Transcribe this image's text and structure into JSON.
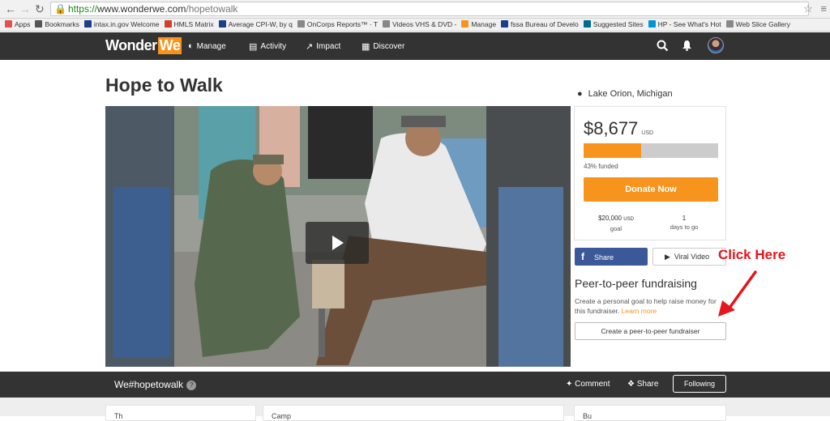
{
  "browser": {
    "url_scheme": "https://",
    "url_host": "www.wonderwe.com",
    "url_path": "/hopetowalk",
    "bookmarks": [
      {
        "label": "Apps",
        "color": "#e45050"
      },
      {
        "label": "Bookmarks",
        "color": "#555555"
      },
      {
        "label": "intax.in.gov Welcome",
        "color": "#1b3f8b"
      },
      {
        "label": "HMLS Matrix",
        "color": "#d33f2a"
      },
      {
        "label": "Average CPI-W, by q",
        "color": "#1b3f8b"
      },
      {
        "label": "OnCorps Reports™ · T",
        "color": "#888888"
      },
      {
        "label": "Videos VHS & DVD -",
        "color": "#888888"
      },
      {
        "label": "Manage",
        "color": "#f7941d"
      },
      {
        "label": "fssa Bureau of Develo",
        "color": "#1b3f8b"
      },
      {
        "label": "Suggested Sites",
        "color": "#006d8f"
      },
      {
        "label": "HP - See What's Hot",
        "color": "#0096d6"
      },
      {
        "label": "Web Slice Gallery",
        "color": "#888888"
      }
    ]
  },
  "site": {
    "logo_part1": "Wonder",
    "logo_part2": "We",
    "nav": [
      {
        "label": "Manage",
        "icon": "◐"
      },
      {
        "label": "Activity",
        "icon": "▤"
      },
      {
        "label": "Impact",
        "icon": "↗"
      },
      {
        "label": "Discover",
        "icon": "▦"
      }
    ]
  },
  "campaign": {
    "title": "Hope to Walk",
    "location": "Lake Orion, Michigan",
    "raised": "$8,677",
    "currency": "USD",
    "percent_funded": 43,
    "funded_label": "43% funded",
    "donate_label": "Donate Now",
    "goal_value": "$20,000",
    "goal_currency": "USD",
    "goal_label": "goal",
    "days_value": "1",
    "days_label": "days to go",
    "share_label": "Share",
    "viral_label": "Viral Video",
    "p2p_title": "Peer-to-peer fundraising",
    "p2p_desc": "Create a personal goal to help raise money for this fundraiser.",
    "learn_more": "Learn more",
    "p2p_button": "Create a peer-to-peer fundraiser"
  },
  "annotation": {
    "text": "Click Here",
    "color": "#e4151c"
  },
  "bottom_bar": {
    "hashtag": "We#hopetowalk",
    "help": "?",
    "comment": "Comment",
    "share": "Share",
    "following": "Following"
  },
  "lower_panels": [
    "Th",
    "Camp",
    "Bu"
  ],
  "colors": {
    "accent": "#f7941d",
    "header_bg": "#333333",
    "facebook": "#3b5998"
  }
}
